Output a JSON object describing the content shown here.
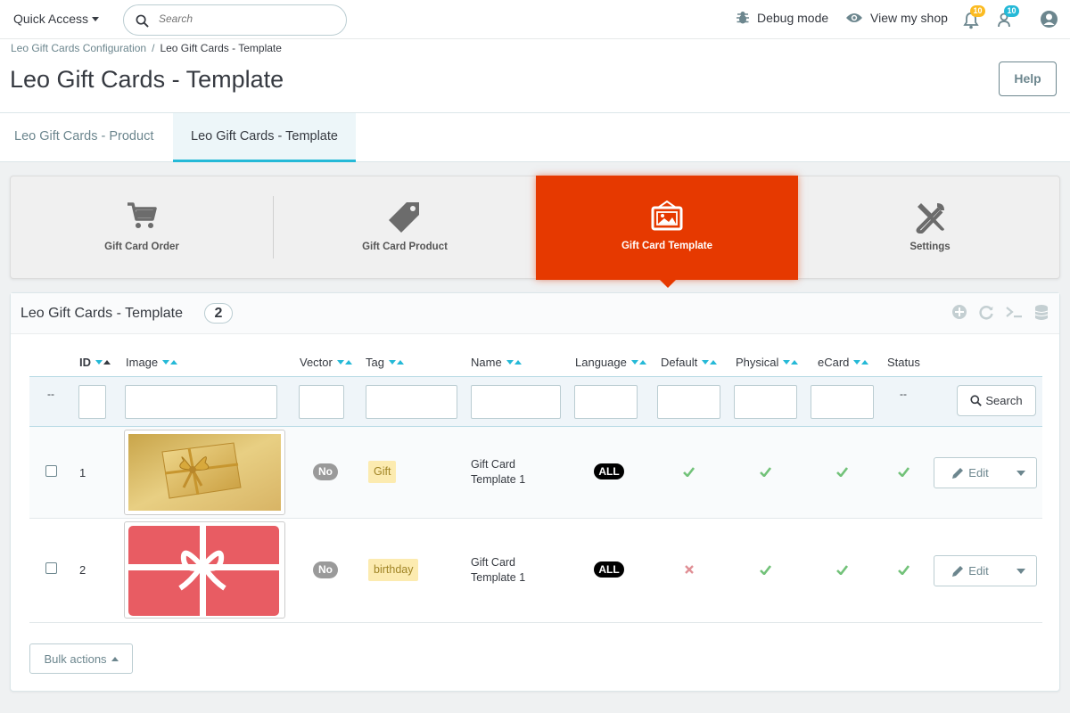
{
  "header": {
    "quick_access": "Quick Access",
    "search_placeholder": "Search",
    "debug_mode": "Debug mode",
    "view_shop": "View my shop",
    "orders_badge": "10",
    "customers_badge": "10"
  },
  "breadcrumb": {
    "parent": "Leo Gift Cards Configuration",
    "separator": "/",
    "current": "Leo Gift Cards - Template"
  },
  "page": {
    "title": "Leo Gift Cards - Template",
    "help_label": "Help"
  },
  "tabs": [
    {
      "label": "Leo Gift Cards - Product",
      "active": false
    },
    {
      "label": "Leo Gift Cards - Template",
      "active": true
    }
  ],
  "module_menu": [
    {
      "label": "Gift Card Order",
      "icon": "cart-icon",
      "active": false
    },
    {
      "label": "Gift Card Product",
      "icon": "tag-icon",
      "active": false
    },
    {
      "label": "Gift Card Template",
      "icon": "image-icon",
      "active": true
    },
    {
      "label": "Settings",
      "icon": "tools-icon",
      "active": false
    }
  ],
  "panel": {
    "title": "Leo Gift Cards - Template",
    "count": "2"
  },
  "table": {
    "columns": [
      "ID",
      "Image",
      "Vector",
      "Tag",
      "Name",
      "Language",
      "Default",
      "Physical",
      "eCard",
      "Status"
    ],
    "filter_dash": "--",
    "status_dash": "--",
    "search_label": "Search",
    "rows": [
      {
        "id": "1",
        "image": "gold-gift-card",
        "vector": "No",
        "tag": "Gift",
        "name_line1": "Gift Card",
        "name_line2": "Template 1",
        "language": "ALL",
        "default": true,
        "physical": true,
        "ecard": true,
        "status": true,
        "edit_label": "Edit"
      },
      {
        "id": "2",
        "image": "red-ribbon-card",
        "vector": "No",
        "tag": "birthday",
        "name_line1": "Gift Card",
        "name_line2": "Template 1",
        "language": "ALL",
        "default": false,
        "physical": true,
        "ecard": true,
        "status": true,
        "edit_label": "Edit"
      }
    ]
  },
  "bulk_actions": "Bulk actions",
  "colors": {
    "accent": "#25b9d7",
    "active_module": "#e63900",
    "check": "#72c279",
    "cross": "#e08f95",
    "tag_bg": "#fcebb0"
  }
}
